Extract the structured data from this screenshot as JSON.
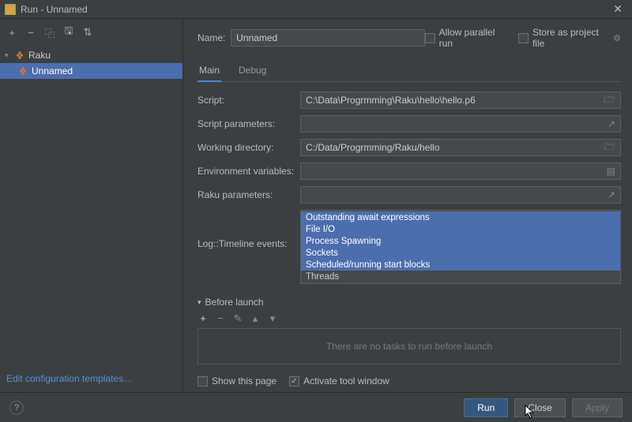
{
  "window": {
    "title": "Run - Unnamed",
    "close_tooltip": "Close"
  },
  "toolbar": {
    "add": "+",
    "remove": "−",
    "copy": "⿻",
    "up_down": "⇅"
  },
  "tree": {
    "raku_label": "Raku",
    "config_label": "Unnamed"
  },
  "edit_templates": "Edit configuration templates…",
  "name_label": "Name:",
  "name_value": "Unnamed",
  "allow_parallel": "Allow parallel run",
  "store_project_file": "Store as project file",
  "tabs": {
    "main": "Main",
    "debug": "Debug"
  },
  "fields": {
    "script": {
      "label": "Script:",
      "value": "C:\\Data\\Progrmming\\Raku\\hello\\hello.p6"
    },
    "script_params": {
      "label": "Script parameters:",
      "value": ""
    },
    "working_dir": {
      "label": "Working directory:",
      "value": "C:/Data/Progrmming/Raku/hello"
    },
    "env_vars": {
      "label": "Environment variables:",
      "value": ""
    },
    "raku_params": {
      "label": "Raku parameters:",
      "value": ""
    }
  },
  "log_events": {
    "label": "Log::Timeline events:",
    "options": [
      {
        "text": "Outstanding await expressions",
        "selected": true
      },
      {
        "text": "File I/O",
        "selected": true
      },
      {
        "text": "Process Spawning",
        "selected": true
      },
      {
        "text": "Sockets",
        "selected": true
      },
      {
        "text": "Scheduled/running start blocks",
        "selected": true
      },
      {
        "text": "Threads",
        "selected": false
      }
    ]
  },
  "before_launch": {
    "title": "Before launch",
    "empty": "There are no tasks to run before launch"
  },
  "show_this_page": "Show this page",
  "activate_tool_window": "Activate tool window",
  "buttons": {
    "run": "Run",
    "close": "Close",
    "apply": "Apply",
    "help": "?"
  }
}
